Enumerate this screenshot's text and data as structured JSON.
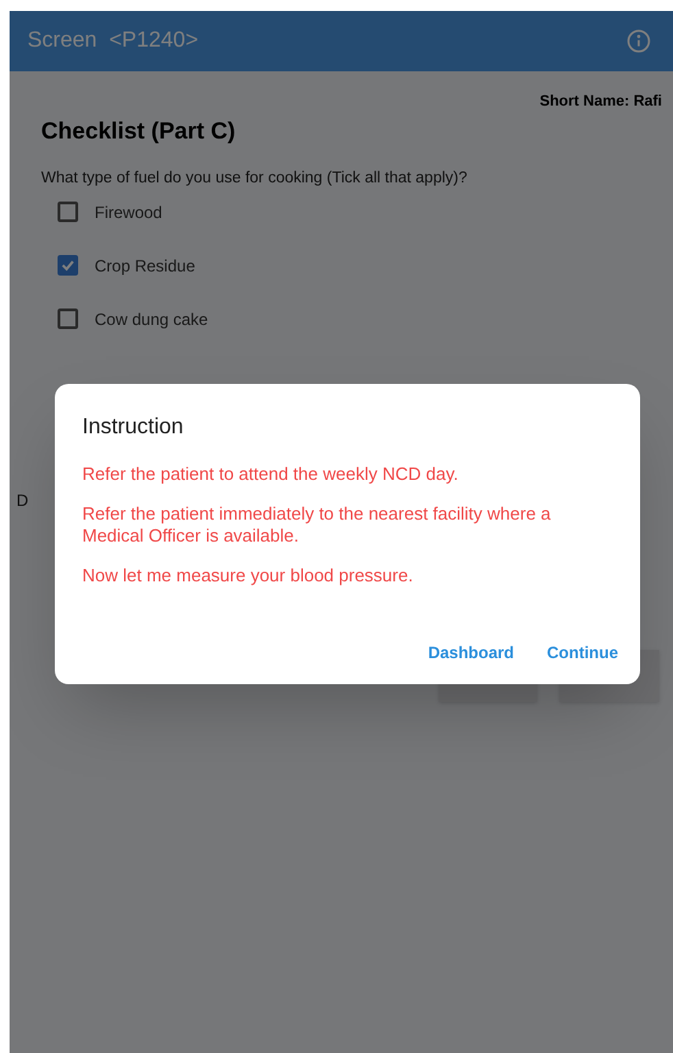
{
  "app_bar": {
    "title": "Screen  <P1240>"
  },
  "short_name": "Short Name: Rafi",
  "title": "Checklist (Part C)",
  "question": "What type of fuel do you use for cooking (Tick all that apply)?",
  "options": [
    {
      "label": "Firewood",
      "checked": false
    },
    {
      "label": "Crop Residue",
      "checked": true
    },
    {
      "label": "Cow dung cake",
      "checked": false
    }
  ],
  "hidden_label": "D",
  "dialog": {
    "title": "Instruction",
    "messages": [
      "Refer the patient to attend the weekly NCD day.",
      "Refer the patient immediately to the nearest facility where a Medical Officer is available.",
      "Now let me measure your blood pressure."
    ],
    "buttons": [
      "Dashboard",
      "Continue"
    ]
  }
}
